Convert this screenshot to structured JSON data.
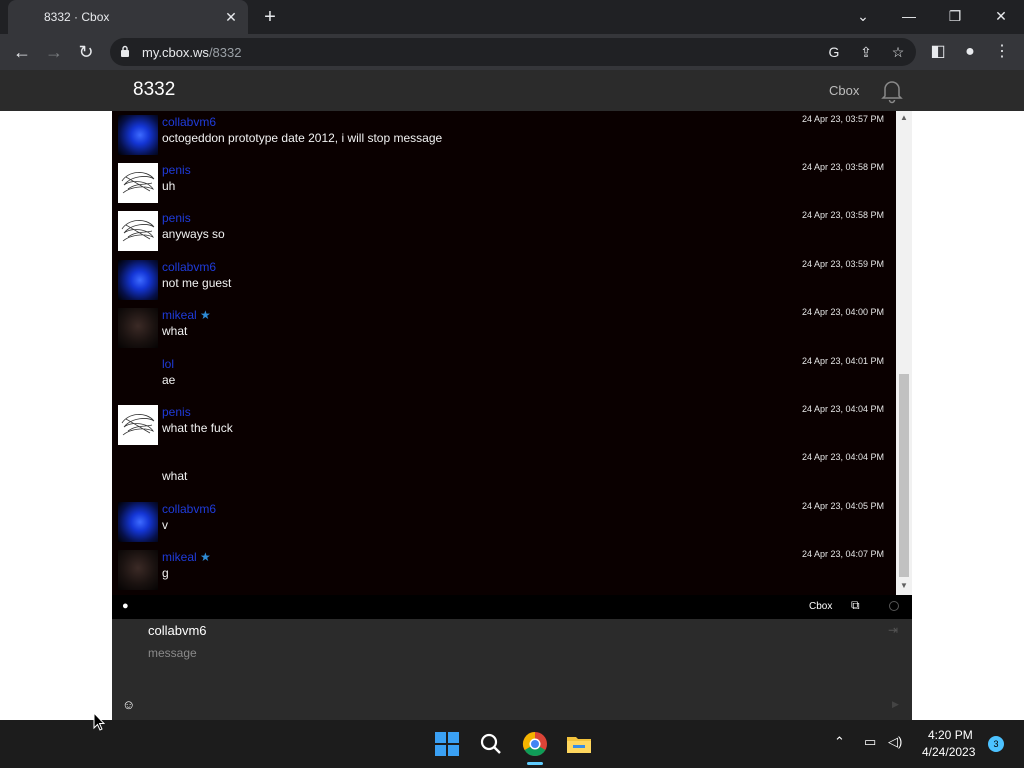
{
  "browser": {
    "tab_title": "8332 · Cbox",
    "url_host": "my.cbox.ws",
    "url_path": "/8332"
  },
  "page": {
    "title": "8332",
    "brand": "Cbox"
  },
  "messages": [
    {
      "user": "collabvm6",
      "text": "octogeddon prototype date 2012, i will stop message",
      "time": "24 Apr 23, 03:57 PM",
      "avatar": "blue",
      "star": false
    },
    {
      "user": "penis",
      "text": "uh",
      "time": "24 Apr 23, 03:58 PM",
      "avatar": "sketch",
      "star": false
    },
    {
      "user": "penis",
      "text": "anyways so",
      "time": "24 Apr 23, 03:58 PM",
      "avatar": "sketch",
      "star": false
    },
    {
      "user": "collabvm6",
      "text": "not me guest",
      "time": "24 Apr 23, 03:59 PM",
      "avatar": "blue",
      "star": false
    },
    {
      "user": "mikeal",
      "text": "what",
      "time": "24 Apr 23, 04:00 PM",
      "avatar": "dark",
      "star": true
    },
    {
      "user": "lol",
      "text": "ae",
      "time": "24 Apr 23, 04:01 PM",
      "avatar": "none",
      "star": false
    },
    {
      "user": "penis",
      "text": "what the fuck",
      "time": "24 Apr 23, 04:04 PM",
      "avatar": "sketch",
      "star": false
    },
    {
      "user": "",
      "text": "what",
      "time": "24 Apr 23, 04:04 PM",
      "avatar": "none",
      "star": false
    },
    {
      "user": "collabvm6",
      "text": "v",
      "time": "24 Apr 23, 04:05 PM",
      "avatar": "blue",
      "star": false
    },
    {
      "user": "mikeal",
      "text": "g",
      "time": "24 Apr 23, 04:07 PM",
      "avatar": "dark",
      "star": true
    }
  ],
  "footer": {
    "brand": "Cbox"
  },
  "compose": {
    "name": "collabvm6",
    "placeholder": "message"
  },
  "taskbar": {
    "time": "4:20 PM",
    "date": "4/24/2023",
    "notifications": "3"
  },
  "colors": {
    "chat_bg": "#0a0000",
    "username": "#1f3bd9",
    "star": "#2e8bd6",
    "header_bg": "#2b2b2b"
  }
}
